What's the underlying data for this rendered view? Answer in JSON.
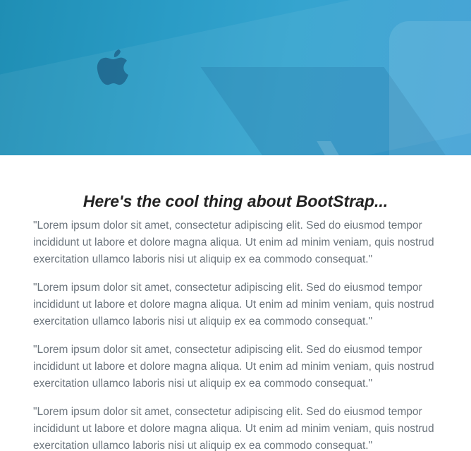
{
  "hero": {
    "logo_icon": "apple-logo-icon",
    "colors": {
      "start": "#1f8eb4",
      "end": "#3c9fd4"
    }
  },
  "main": {
    "heading": "Here's the cool thing about BootStrap...",
    "paragraphs": [
      {
        "line1": "\"Lorem ipsum dolor sit amet, consectetur adipiscing elit. Sed do eiusmod tempor",
        "line2": "incididunt ut labore et dolore magna aliqua. Ut enim ad minim veniam, quis",
        "line3": "nostrud exercitation ullamco laboris nisi ut aliquip ex ea commodo consequat.\""
      },
      {
        "line1": "\"Lorem ipsum dolor sit amet, consectetur adipiscing elit. Sed do eiusmod tempor",
        "line2": "incididunt ut labore et dolore magna aliqua. Ut enim ad minim veniam, quis",
        "line3": "nostrud exercitation ullamco laboris nisi ut aliquip ex ea commodo consequat.\""
      },
      {
        "line1": "\"Lorem ipsum dolor sit amet, consectetur adipiscing elit. Sed do eiusmod tempor",
        "line2": "incididunt ut labore et dolore magna aliqua. Ut enim ad minim veniam, quis",
        "line3": "nostrud exercitation ullamco laboris nisi ut aliquip ex ea commodo consequat.\""
      },
      {
        "line1": "\"Lorem ipsum dolor sit amet, consectetur adipiscing elit. Sed do eiusmod tempor",
        "line2": "incididunt ut labore et dolore magna aliqua. Ut enim ad minim veniam, quis",
        "line3": "nostrud exercitation ullamco laboris nisi ut aliquip ex ea commodo consequat.\""
      }
    ],
    "colors": {
      "heading": "#222222",
      "body_text": "#6c757d"
    }
  }
}
